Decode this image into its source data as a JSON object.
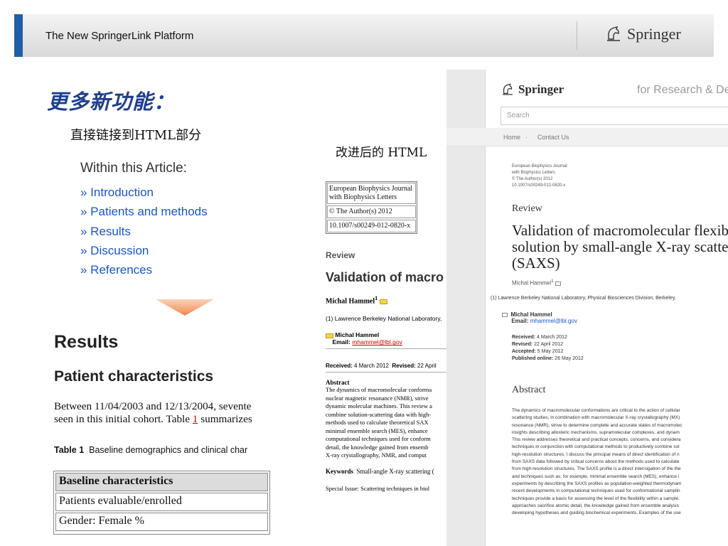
{
  "header": {
    "title": "The New SpringerLink Platform",
    "brand": "Springer",
    "accent_color": "#1f5fa8"
  },
  "left": {
    "heading": "更多新功能：",
    "subheading": "直接链接到HTML部分",
    "within_title": "Within this Article:",
    "toc": [
      "» Introduction",
      "» Patients and methods",
      "» Results",
      "» Discussion",
      "» References"
    ],
    "results_heading": "Results",
    "patient_heading": "Patient characteristics",
    "paragraph_line1": "Between 11/04/2003 and 12/13/2004, sevente",
    "paragraph_line2_pre": "seen in this initial cohort. Table ",
    "paragraph_ref": "1",
    "paragraph_line2_post": " summarizes",
    "table_label": "Table 1",
    "table_caption": "Baseline demographics and clinical char",
    "table_rows": [
      "Baseline characteristics",
      "Patients evaluable/enrolled",
      "Gender: Female %"
    ]
  },
  "middle": {
    "title": "改进后的 HTML",
    "journal_box": [
      "European Biophysics Journal with Biophysics Letters",
      "© The Author(s) 2012",
      "10.1007/s00249-012-0820-x"
    ],
    "review": "Review",
    "validation": "Validation of macro",
    "author": "Michal Hammel",
    "author_sup": "1",
    "affiliation": "(1)  Lawrence Berkeley National Laboratory,",
    "contact_name": "Michal Hammel",
    "email_label": "Email:",
    "email": "mhammel@lbl.gov",
    "received": "Received:",
    "received_val": "4 March 2012",
    "revised": "Revised:",
    "revised_val": "22 April",
    "abstract_heading": "Abstract",
    "abstract_lines": [
      "The dynamics of macromolecular conforma",
      "nuclear magnetic resonance (NMR), strive",
      "dynamic molecular machines. This review a",
      "combine solution-scattering data with high-",
      "methods used to calculate theoretical SAX",
      "minimal ensemble search (MES), enhance",
      "computational techniques used for conform",
      "detail, the knowledge gained from ensemb",
      "X-ray crystallography, NMR, and comput"
    ],
    "keywords_label": "Keywords",
    "keywords": "Small-angle X-ray scattering (",
    "special_issue": "Special Issue: Scattering techniques in biol"
  },
  "panel": {
    "brand": "Springer",
    "tagline": "for Research & Deve",
    "search_placeholder": "Search",
    "nav_home": "Home",
    "nav_sep": "·",
    "nav_contact": "Contact Us",
    "meta": [
      "European Biophysics Journal",
      "with Biophysics Letters",
      "© The Author(s) 2012",
      "10.1007/s00249-012-0820-x"
    ],
    "review": "Review",
    "title_lines": [
      "Validation of macromolecular flexib",
      "solution by small-angle X-ray scatte",
      "(SAXS)"
    ],
    "author": "Michal Hammel",
    "author_sup": "1",
    "affiliation": "(1)  Lawrence Berkeley National Laboratory, Physical Biosciences Division, Berkeley,",
    "contact_name": "Michal Hammel",
    "email_label": "Email:",
    "email": "mhammel@lbl.gov",
    "dates": [
      {
        "label": "Received:",
        "value": "4 March 2012"
      },
      {
        "label": "Revised:",
        "value": "22 April 2012"
      },
      {
        "label": "Accepted:",
        "value": "5 May 2012"
      },
      {
        "label": "Published online:",
        "value": "26 May 2012"
      }
    ],
    "abstract_heading": "Abstract",
    "abstract_lines": [
      "The dynamics of macromolecular conformations are critical to the action of cellular",
      "scattering studies, in combination with macromolecular X-ray crystallography (MX)",
      "resonance (NMR), strive to determine complete and accurate states of macromolec",
      "insights describing allosteric mechanisms, supramolecular complexes, and dynam",
      "This review addresses theoretical and practical concepts, concerns, and considera",
      "techniques in conjunction with computational methods to productively combine sol",
      "high-resolution structures. I discuss the principal means of direct identification of n",
      "from SAXS data followed by critical concerns about the methods used to calculate",
      "from high-resolution structures. The SAXS profile is a direct interrogation of the the",
      "and techniques such as, for example, minimal ensemble search (MES), enhance i",
      "experiments by describing the SAXS profiles as population-weighted thermodynam",
      "recent developments in computational techniques used for conformational samplin",
      "techniques provide a basis for assessing the level of the flexibility within a sample.",
      "approaches sacrifice atomic detail, the knowledge gained from ensemble analysis",
      "developing hypotheses and guiding biochemical experiments. Examples of the use"
    ]
  }
}
